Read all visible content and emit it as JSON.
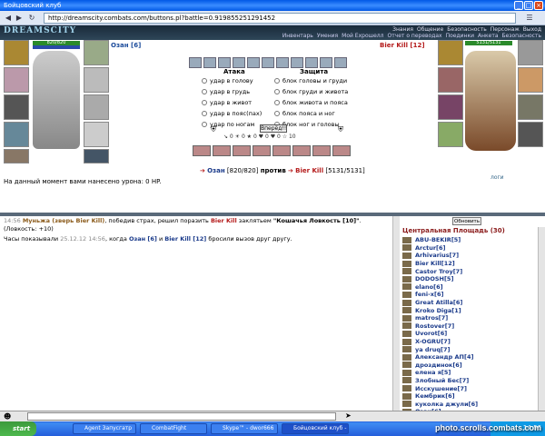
{
  "browser": {
    "title": "Бойцовский клуб",
    "url": "http://dreamscity.combats.com/buttons.pl?battle=0.919855251291452"
  },
  "game_header": {
    "logo": "DREAMSCITY",
    "menu": [
      "Знания",
      "Общение",
      "Безопасность",
      "Персонаж",
      "Выход"
    ],
    "submenu": [
      "Инвентарь",
      "Умения",
      "Мой Ехрошелл",
      "Отчет о переводах",
      "Поединки",
      "Анкета",
      "Безопасность"
    ]
  },
  "left_char": {
    "name": "Озан [6]",
    "hp": "820/820"
  },
  "right_char": {
    "name": "Bier Kill [12]",
    "hp": "5131/5131"
  },
  "combat": {
    "attack_header": "Атака",
    "defense_header": "Защита",
    "attacks": [
      "удар в голову",
      "удар в грудь",
      "удар в живот",
      "удар в пояс(пах)",
      "удар по ногам"
    ],
    "defenses": [
      "блок головы и груди",
      "блок груди и живота",
      "блок живота и пояса",
      "блок пояса и ног",
      "блок ног и головы"
    ],
    "forward_button": "Вперёд!!",
    "stats": "↘ 0  ☀ 0  ★ 0  ♥ 0  ♥ 0  ☆ 10"
  },
  "versus": {
    "left": "Озан",
    "left_hp": "[820/820]",
    "word": "против",
    "right": "Bier Kill",
    "right_hp": "[5131/5131]"
  },
  "damage_text": "На данный момент вами нанесено урона: 0 HP.",
  "logs_link": "логи",
  "chat": {
    "lines": [
      {
        "time": "14:56",
        "parts": [
          "Муньжа (зверь Bier Kill)",
          ", победив страх, решил поразить ",
          "Bier Kill",
          " заклятьем ",
          "\"Кошачья Ловкость [10]\"",
          ". (Ловкость: +10)"
        ]
      },
      {
        "pre": "Часы показывали ",
        "time": "25.12.12 14:56",
        "mid": ", когда ",
        "a": "Озан [6]",
        "and": " и ",
        "b": "Bier Kill [12]",
        "post": " бросили вызов друг другу."
      }
    ]
  },
  "sidebar": {
    "refresh_button": "Обновить",
    "place": "Центральная Площадь (30)",
    "players": [
      "ABU-BEKIR[5]",
      "Arctur[6]",
      "Arhivarius[7]",
      "Bier Kill[12]",
      "Castor Troy[7]",
      "DODOSH[5]",
      "elano[6]",
      "feni-x[6]",
      "Great Atilla[6]",
      "Kroko Diga[1]",
      "matros[7]",
      "Rostover[7]",
      "Uvorot[6]",
      "X-OGRU[7]",
      "ya druq[7]",
      "Александр АП[4]",
      "дроздинок[6]",
      "елена я[5]",
      "Злобный Бес[7]",
      "Исскушение[7]",
      "Кембрик[6]",
      "куколка джули[6]",
      "Озан[6]"
    ]
  },
  "taskbar": {
    "start": "start",
    "tasks": [
      "Agent Запусгатр",
      "CombatFight",
      "Skype™ - dwor666",
      "Бойцовский клуб - ..."
    ],
    "clock": "14:56"
  },
  "watermark": "photo.scrolls.combats.com"
}
